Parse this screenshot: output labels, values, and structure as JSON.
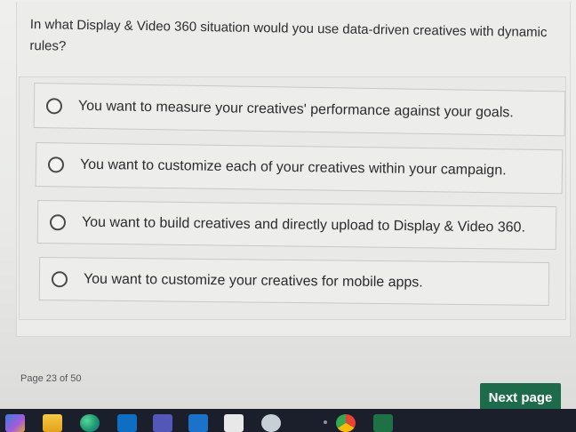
{
  "question": {
    "text": "In what Display & Video 360 situation would you use data-driven creatives with dynamic rules?"
  },
  "options": [
    {
      "label": "You want to measure your creatives' performance against your goals."
    },
    {
      "label": "You want to customize each of your creatives within your campaign."
    },
    {
      "label": "You want to build creatives and directly upload to Display & Video 360."
    },
    {
      "label": "You want to customize your creatives for mobile apps."
    }
  ],
  "footer": {
    "page_indicator": "Page 23 of 50",
    "next_button": "Next page"
  },
  "colors": {
    "accent": "#1d6b4a",
    "background": "#eceeeb"
  },
  "taskbar": {
    "icons": [
      "widgets-icon",
      "file-explorer-icon",
      "edge-browser-icon",
      "outlook-icon",
      "teams-icon",
      "office-icon",
      "calendar-icon",
      "game-icon",
      "chrome-icon",
      "excel-icon"
    ]
  }
}
